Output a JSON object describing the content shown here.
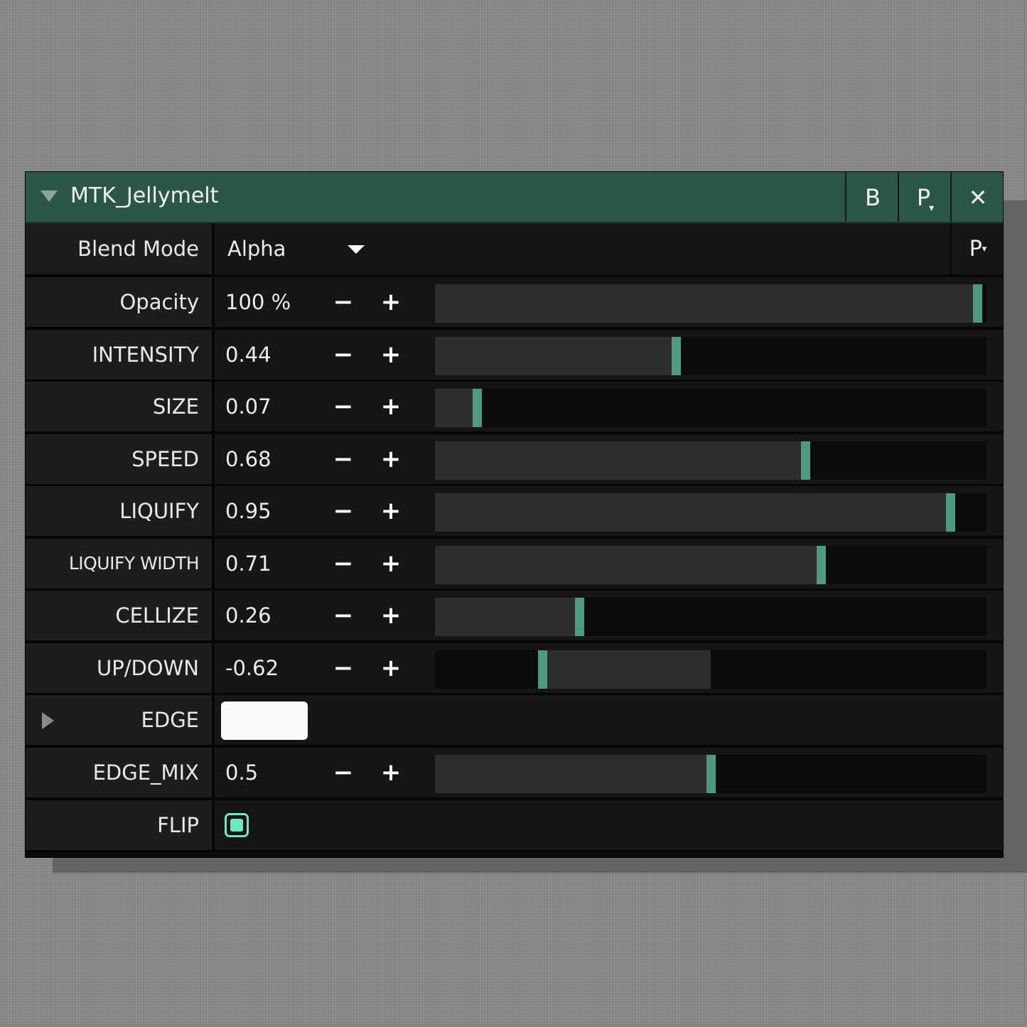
{
  "window": {
    "title": "MTK_Jellymelt",
    "buttons": {
      "bypass": "B",
      "preset": "P",
      "close": "✕"
    }
  },
  "blend": {
    "label": "Blend Mode",
    "value": "Alpha",
    "preset": "P"
  },
  "controls": {
    "minus": "−",
    "plus": "+"
  },
  "params": [
    {
      "label": "Opacity",
      "display": "100 %",
      "fraction": 1.0
    },
    {
      "label": "INTENSITY",
      "display": "0.44",
      "fraction": 0.44
    },
    {
      "label": "SIZE",
      "display": "0.07",
      "fraction": 0.07
    },
    {
      "label": "SPEED",
      "display": "0.68",
      "fraction": 0.68
    },
    {
      "label": "LIQUIFY",
      "display": "0.95",
      "fraction": 0.95
    },
    {
      "label": "LIQUIFY WIDTH",
      "display": "0.71",
      "fraction": 0.71
    },
    {
      "label": "CELLIZE",
      "display": "0.26",
      "fraction": 0.26
    },
    {
      "label": "UP/DOWN",
      "display": "-0.62",
      "value": -0.62,
      "min": -1,
      "max": 1
    }
  ],
  "edge": {
    "label": "EDGE",
    "color": "#fafafa"
  },
  "edge_mix": {
    "label": "EDGE_MIX",
    "display": "0.5",
    "fraction": 0.5
  },
  "flip": {
    "label": "FLIP",
    "checked": true
  },
  "colors": {
    "accent": "#4e9a7f",
    "title_bg": "#2c5748",
    "check": "#6fe8c2"
  }
}
